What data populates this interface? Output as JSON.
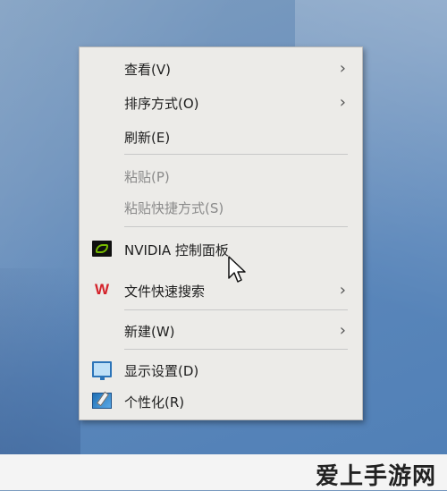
{
  "context_menu": {
    "items": [
      {
        "label": "查看(V)",
        "submenu": true,
        "enabled": true
      },
      {
        "label": "排序方式(O)",
        "submenu": true,
        "enabled": true
      },
      {
        "label": "刷新(E)",
        "submenu": false,
        "enabled": true
      },
      {
        "label": "粘贴(P)",
        "submenu": false,
        "enabled": false
      },
      {
        "label": "粘贴快捷方式(S)",
        "submenu": false,
        "enabled": false
      },
      {
        "label": "NVIDIA 控制面板",
        "submenu": false,
        "enabled": true,
        "icon": "nvidia-icon"
      },
      {
        "label": "文件快速搜索",
        "submenu": true,
        "enabled": true,
        "icon": "wps-icon"
      },
      {
        "label": "新建(W)",
        "submenu": true,
        "enabled": true
      },
      {
        "label": "显示设置(D)",
        "submenu": false,
        "enabled": true,
        "icon": "display-settings-icon"
      },
      {
        "label": "个性化(R)",
        "submenu": false,
        "enabled": true,
        "icon": "personalize-icon"
      }
    ],
    "submenu_arrow": "›",
    "wps_glyph": "W"
  },
  "watermark": {
    "text": "爱上手游网"
  },
  "colors": {
    "menu_bg": "#ecebe8",
    "disabled_text": "#8a8a8a",
    "nvidia_green": "#76b900",
    "wps_red": "#d4232b"
  }
}
